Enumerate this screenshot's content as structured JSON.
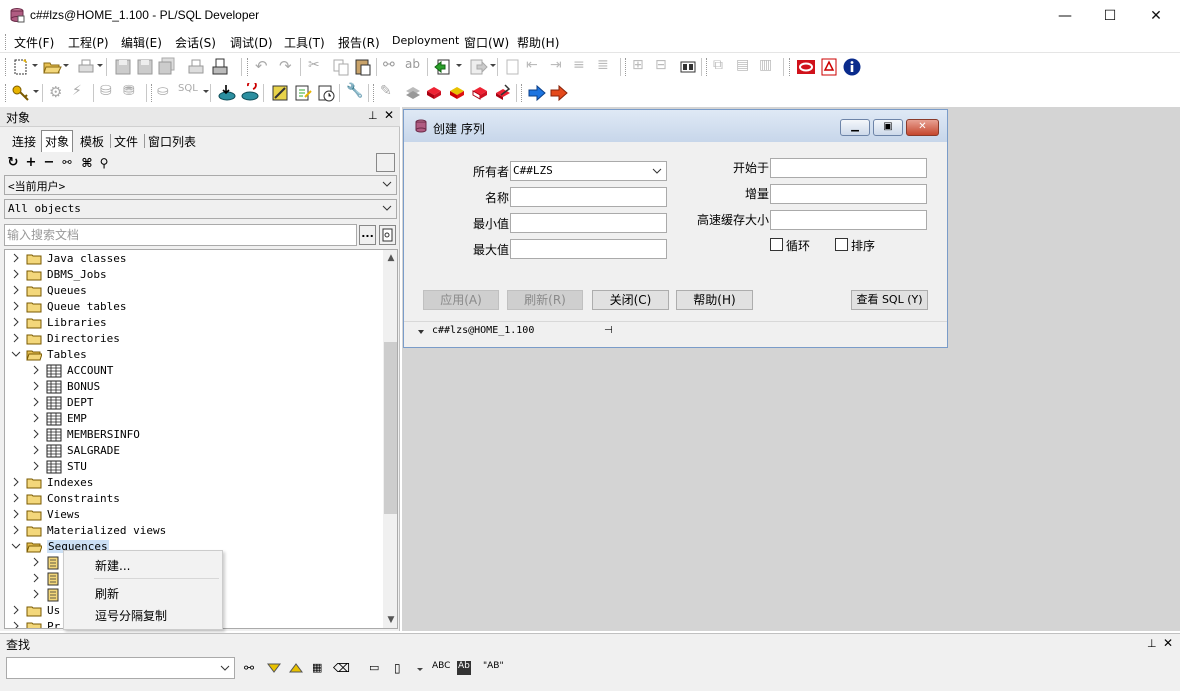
{
  "window": {
    "title": "c##lzs@HOME_1.100 - PL/SQL Developer",
    "minimize": "—",
    "maximize": "☐",
    "close": "✕"
  },
  "menu": [
    "文件(F)",
    "工程(P)",
    "编辑(E)",
    "会话(S)",
    "调试(D)",
    "工具(T)",
    "报告(R)",
    "Deployment",
    "窗口(W)",
    "帮助(H)"
  ],
  "left_panel": {
    "title": "对象",
    "tabs": [
      "连接",
      "对象",
      "模板",
      "文件",
      "窗口列表"
    ],
    "active_tab": "对象",
    "user_combo": "<当前用户>",
    "filter_combo": "All objects",
    "search_placeholder": "输入搜索文档",
    "dots_label": "...",
    "tree": [
      {
        "label": "Java classes",
        "type": "folder",
        "expanded": false
      },
      {
        "label": "DBMS_Jobs",
        "type": "folder",
        "expanded": false
      },
      {
        "label": "Queues",
        "type": "folder",
        "expanded": false
      },
      {
        "label": "Queue tables",
        "type": "folder",
        "expanded": false
      },
      {
        "label": "Libraries",
        "type": "folder",
        "expanded": false
      },
      {
        "label": "Directories",
        "type": "folder",
        "expanded": false
      },
      {
        "label": "Tables",
        "type": "folder",
        "expanded": true
      },
      {
        "label": "ACCOUNT",
        "type": "table"
      },
      {
        "label": "BONUS",
        "type": "table"
      },
      {
        "label": "DEPT",
        "type": "table"
      },
      {
        "label": "EMP",
        "type": "table"
      },
      {
        "label": "MEMBERSINFO",
        "type": "table"
      },
      {
        "label": "SALGRADE",
        "type": "table"
      },
      {
        "label": "STU",
        "type": "table"
      },
      {
        "label": "Indexes",
        "type": "folder",
        "expanded": false
      },
      {
        "label": "Constraints",
        "type": "folder",
        "expanded": false
      },
      {
        "label": "Views",
        "type": "folder",
        "expanded": false
      },
      {
        "label": "Materialized views",
        "type": "folder",
        "expanded": false
      },
      {
        "label": "Sequences",
        "type": "folder",
        "expanded": true,
        "selected": true
      },
      {
        "label": "",
        "type": "sequence"
      },
      {
        "label": "",
        "type": "sequence"
      },
      {
        "label": "",
        "type": "sequence"
      },
      {
        "label": "Us",
        "type": "folder",
        "expanded": false
      },
      {
        "label": "Pr",
        "type": "folder",
        "expanded": false
      }
    ]
  },
  "context_menu": {
    "items": [
      "新建...",
      "刷新",
      "逗号分隔复制"
    ]
  },
  "dialog": {
    "title": "创建 序列",
    "owner_label": "所有者",
    "owner_value": "C##LZS",
    "name_label": "名称",
    "name_value": "",
    "min_label": "最小值",
    "min_value": "",
    "max_label": "最大值",
    "max_value": "",
    "start_label": "开始于",
    "start_value": "",
    "increment_label": "增量",
    "increment_value": "",
    "cache_label": "高速缓存大小",
    "cache_value": "",
    "cycle_label": "循环",
    "order_label": "排序",
    "apply_button": "应用(A)",
    "refresh_button": "刷新(R)",
    "close_button": "关闭(C)",
    "help_button": "帮助(H)",
    "view_sql_button": "查看 SQL (Y)",
    "status_connection": "c##lzs@HOME_1.100"
  },
  "find_panel": {
    "title": "查找",
    "search_value": "",
    "abc_label": "ABC",
    "ab_label": "Ab",
    "quoted_label": "\"AB\""
  },
  "colors": {
    "mdi_background": "#d4d4d4",
    "dialog_title_gradient": "#c7d6ea",
    "selection": "#cce0f5"
  }
}
